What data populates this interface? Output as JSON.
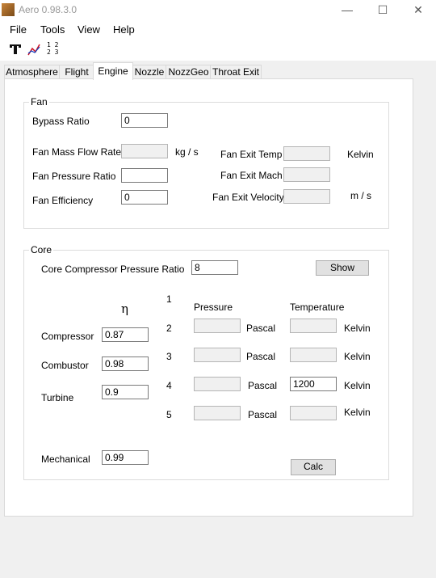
{
  "window": {
    "title": "Aero 0.98.3.0",
    "minimize": "—",
    "maximize": "☐",
    "close": "✕"
  },
  "menu": [
    "File",
    "Tools",
    "View",
    "Help"
  ],
  "toolbar": {
    "icons": [
      "text-tool-icon",
      "line-chart-icon",
      "number-grid-icon"
    ],
    "grid_top": "1 2",
    "grid_bottom": "2 3"
  },
  "tabs": [
    "Atmosphere",
    "Flight",
    "Engine",
    "Nozzle",
    "NozzGeo",
    "Throat Exit"
  ],
  "active_tab": "Engine",
  "fan": {
    "title": "Fan",
    "bypass_label": "Bypass Ratio",
    "bypass_value": "0",
    "massflow_label": "Fan Mass Flow Rate",
    "massflow_value": "",
    "massflow_unit": "kg / s",
    "pressure_label": "Fan Pressure Ratio",
    "pressure_value": "",
    "efficiency_label": "Fan Efficiency",
    "efficiency_value": "0",
    "exit_temp_label": "Fan Exit Temp",
    "exit_temp_value": "",
    "exit_temp_unit": "Kelvin",
    "exit_mach_label": "Fan Exit Mach",
    "exit_mach_value": "",
    "exit_vel_label": "Fan Exit Velocity",
    "exit_vel_value": "",
    "exit_vel_unit": "m / s"
  },
  "core": {
    "title": "Core",
    "cpr_label": "Core Compressor Pressure Ratio",
    "cpr_value": "8",
    "show_button": "Show",
    "eta_symbol": "η",
    "compressor_label": "Compressor",
    "compressor_value": "0.87",
    "combustor_label": "Combustor",
    "combustor_value": "0.98",
    "turbine_label": "Turbine",
    "turbine_value": "0.9",
    "mechanical_label": "Mechanical",
    "mechanical_value": "0.99",
    "pressure_header": "Pressure",
    "temperature_header": "Temperature",
    "stations": [
      {
        "num": "1"
      },
      {
        "num": "2",
        "pressure": "",
        "pressure_unit": "Pascal",
        "temperature": "",
        "temp_unit": "Kelvin"
      },
      {
        "num": "3",
        "pressure": "",
        "pressure_unit": "Pascal",
        "temperature": "",
        "temp_unit": "Kelvin"
      },
      {
        "num": "4",
        "pressure": "",
        "pressure_unit": "Pascal",
        "temperature": "1200",
        "temp_unit": "Kelvin"
      },
      {
        "num": "5",
        "pressure": "",
        "pressure_unit": "Pascal",
        "temperature": "",
        "temp_unit": "Kelvin"
      }
    ],
    "calc_button": "Calc"
  }
}
